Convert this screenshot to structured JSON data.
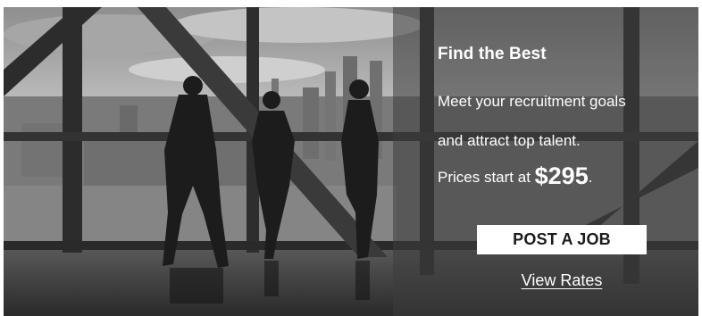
{
  "banner": {
    "headline": "Find the Best",
    "line1": "Meet your recruitment goals",
    "line2": "and attract top talent.",
    "price_prefix": "Prices start at ",
    "price": "$295",
    "price_suffix": ".",
    "post_job_label": "POST A JOB",
    "view_rates_label": "View Rates"
  },
  "colors": {
    "overlay": "#3c3c3c",
    "text": "#ffffff",
    "button_bg": "#ffffff",
    "button_text": "#1a1a1a"
  }
}
